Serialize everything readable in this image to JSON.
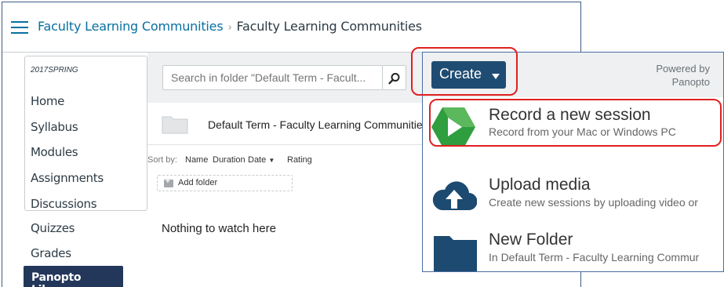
{
  "header": {
    "breadcrumb_course": "Faculty Learning Communities",
    "breadcrumb_separator": "›",
    "breadcrumb_current": "Faculty Learning Communities"
  },
  "nav": {
    "term": "2017SPRING",
    "items": [
      "Home",
      "Syllabus",
      "Modules",
      "Assignments",
      "Discussions",
      "Quizzes",
      "Grades"
    ],
    "active_item": "Panopto Library"
  },
  "panopto": {
    "search_placeholder": "Search in folder \"Default Term - Facult...",
    "folder_title": "Default Term - Faculty Learning Communities",
    "sort_label": "Sort by:",
    "sort_options": [
      "Name",
      "Duration",
      "Date",
      "Rating"
    ],
    "sort_active": "Date",
    "add_folder_label": "Add folder",
    "empty_message": "Nothing to watch here"
  },
  "popup": {
    "create_label": "Create",
    "powered_by_line1": "Powered by",
    "powered_by_line2": "Panopto",
    "menu": [
      {
        "title": "Record a new session",
        "subtitle": "Record from your Mac or Windows PC",
        "icon": "panopto-record-icon"
      },
      {
        "title": "Upload media",
        "subtitle": "Create new sessions by uploading video or",
        "icon": "cloud-upload-icon"
      },
      {
        "title": "New Folder",
        "subtitle": "In Default Term - Faculty Learning Commur",
        "icon": "folder-icon"
      }
    ]
  },
  "colors": {
    "link": "#0770a3",
    "nav_active_bg": "#23375b",
    "create_bg": "#1f4c72",
    "highlight": "#e02020",
    "panopto_green": "#2e9e3e"
  }
}
